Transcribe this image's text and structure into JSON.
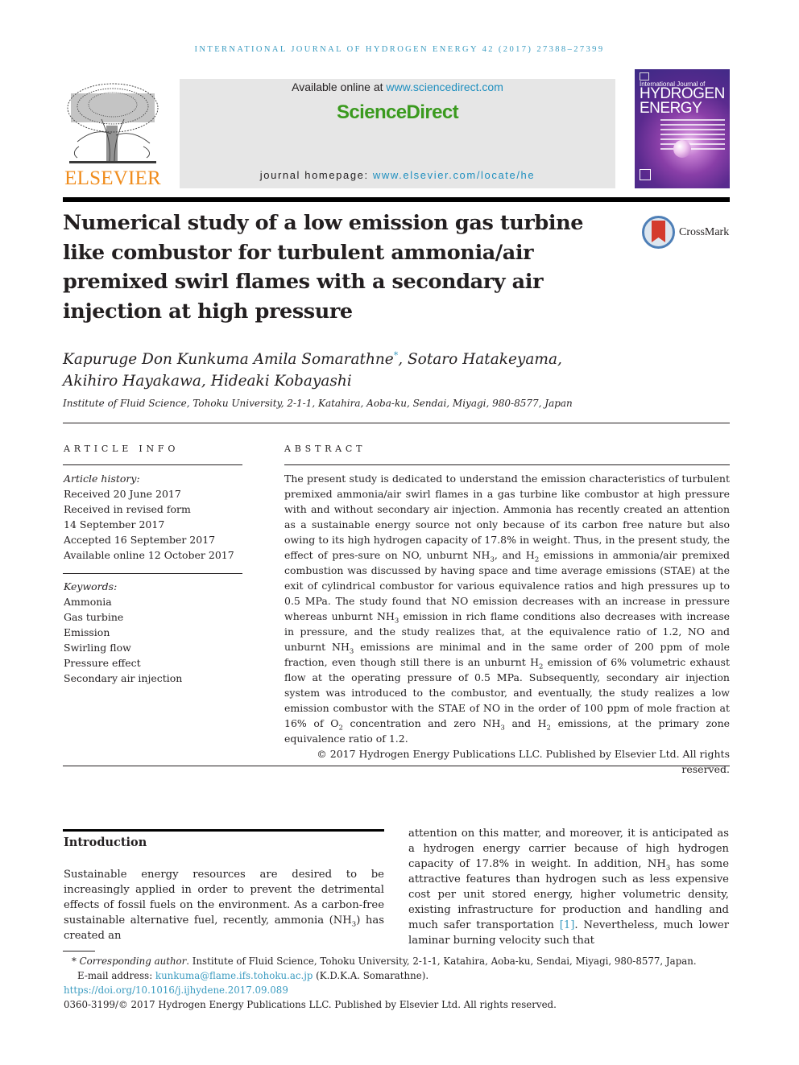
{
  "running_head": "International Journal of Hydrogen Energy 42 (2017) 27388–27399",
  "publisher": {
    "logo_icon": "elsevier-tree-icon",
    "name": "ELSEVIER"
  },
  "sciencedirect_banner": {
    "available_prefix": "Available online at ",
    "available_link": "www.sciencedirect.com",
    "brand": "ScienceDirect",
    "homepage_prefix": "journal homepage: ",
    "homepage_link": "www.elsevier.com/locate/he",
    "brand_color": "#3a9a1e",
    "link_color": "#1f8fbf"
  },
  "journal_cover": {
    "line1": "International Journal of",
    "line2": "HYDROGEN",
    "line3": "ENERGY"
  },
  "crossmark": {
    "icon": "crossmark-icon",
    "label": "CrossMark"
  },
  "article": {
    "title": "Numerical study of a low emission gas turbine like combustor for turbulent ammonia/air premixed swirl flames with a secondary air injection at high pressure",
    "authors": {
      "a1": "Kapuruge Don Kunkuma Amila Somarathne",
      "a1_mark": "*",
      "rest_line1": ", Sotaro Hatakeyama,",
      "line2": "Akihiro Hayakawa, Hideaki Kobayashi"
    },
    "affiliation": "Institute of Fluid Science, Tohoku University, 2-1-1, Katahira, Aoba-ku, Sendai, Miyagi, 980-8577, Japan"
  },
  "article_info": {
    "heading": "ARTICLE INFO",
    "history_label": "Article history:",
    "history": [
      "Received 20 June 2017",
      "Received in revised form",
      "14 September 2017",
      "Accepted 16 September 2017",
      "Available online 12 October 2017"
    ],
    "keywords_label": "Keywords:",
    "keywords": [
      "Ammonia",
      "Gas turbine",
      "Emission",
      "Swirling flow",
      "Pressure effect",
      "Secondary air injection"
    ]
  },
  "abstract": {
    "heading": "ABSTRACT",
    "p1": "The present study is dedicated to understand the emission characteristics of turbulent premixed ammonia/air swirl flames in a gas turbine like combustor at high pressure with and without secondary air injection. Ammonia has recently created an attention as a sustainable energy source not only because of its carbon free nature but also owing to its high hydrogen capacity of 17.8% in weight. Thus, in the present study, the effect of pres-sure on NO, unburnt NH",
    "s1": "3",
    "p2": ", and H",
    "s2": "2",
    "p3": " emissions in ammonia/air premixed combustion was discussed by having space and time average emissions (STAE) at the exit of cylindrical combustor for various equivalence ratios and high pressures up to 0.5 MPa. The study found that NO emission decreases with an increase in pressure whereas unburnt NH",
    "s3": "3",
    "p4": " emission in rich flame conditions also decreases with increase in pressure, and the study realizes that, at the equivalence ratio of 1.2, NO and unburnt NH",
    "s4": "3",
    "p5": " emissions are minimal and in the same order of 200 ppm of mole fraction, even though still there is an unburnt H",
    "s5": "2",
    "p6": " emission of 6% volumetric exhaust flow at the operating pressure of 0.5 MPa. Subsequently, secondary air injection system was introduced to the combustor, and eventually, the study realizes a low emission combustor with the STAE of NO in the order of 100 ppm of mole fraction at 16% of O",
    "s6": "2",
    "p7": " concentration and zero NH",
    "s7": "3",
    "p8": " and H",
    "s8": "2",
    "p9": " emissions, at the primary zone equivalence ratio of 1.2.",
    "copyright": "© 2017 Hydrogen Energy Publications LLC. Published by Elsevier Ltd. All rights reserved."
  },
  "introduction": {
    "heading": "Introduction",
    "left_p1": "Sustainable energy resources are desired to be increasingly applied in order to prevent the detrimental effects of fossil fuels on the environment. As a carbon-free sustainable alternative fuel, recently, ammonia (NH",
    "left_s1": "3",
    "left_p2": ") has created an",
    "right_p1": "attention on this matter, and moreover, it is anticipated as a hydrogen energy carrier because of high hydrogen capacity of 17.8% in weight. In addition, NH",
    "right_s1": "3",
    "right_p2": " has some attractive features than hydrogen such as less expensive cost per unit stored energy, higher volumetric density, existing infrastructure for production and handling and much safer transportation ",
    "right_ref": "[1]",
    "right_p3": ". Nevertheless, much lower laminar burning velocity such that"
  },
  "footnotes": {
    "mark": "*",
    "corresponding_label": "Corresponding author",
    "corresponding_text": ". Institute of Fluid Science, Tohoku University, 2-1-1, Katahira, Aoba-ku, Sendai, Miyagi, 980-8577, Japan.",
    "email_label": "E-mail address: ",
    "email": "kunkuma@flame.ifs.tohoku.ac.jp",
    "email_suffix": " (K.D.K.A. Somarathne).",
    "doi": "https://doi.org/10.1016/j.ijhydene.2017.09.089",
    "issn_line": "0360-3199/© 2017 Hydrogen Energy Publications LLC. Published by Elsevier Ltd. All rights reserved."
  }
}
